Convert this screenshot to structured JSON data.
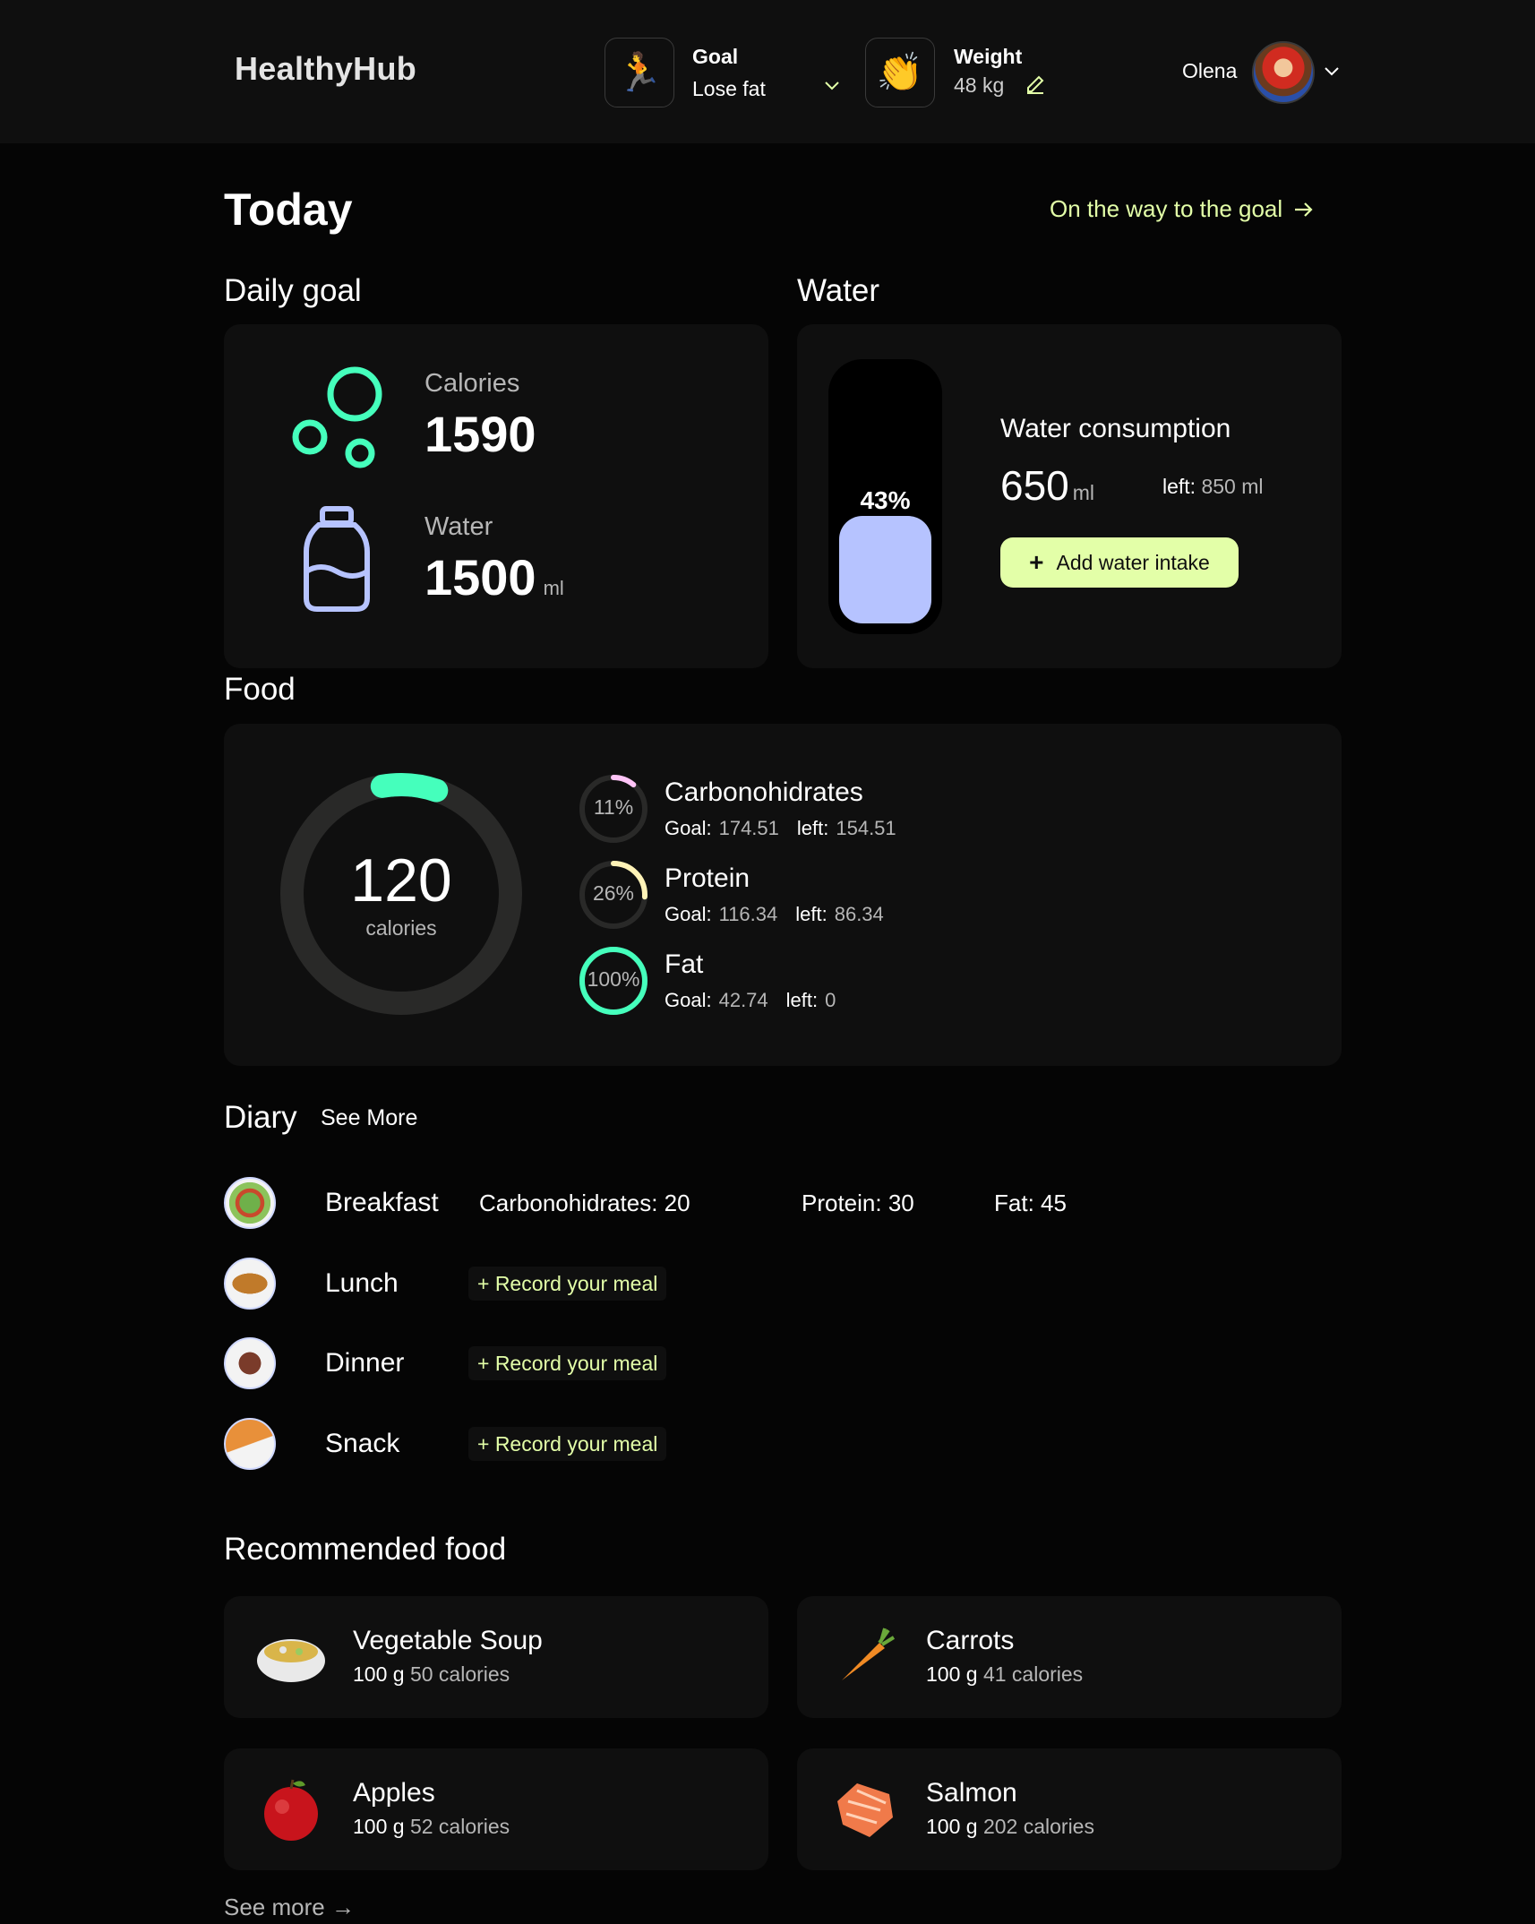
{
  "header": {
    "logo": "HealthyHub",
    "goal": {
      "label": "Goal",
      "value": "Lose fat",
      "icon": "running-person-icon"
    },
    "weight": {
      "label": "Weight",
      "value": "48 kg",
      "icon": "clapping-hands-icon"
    },
    "user": {
      "name": "Olena"
    }
  },
  "today": {
    "title": "Today",
    "goal_link": "On the way to the goal"
  },
  "daily_goal": {
    "title": "Daily goal",
    "calories_label": "Calories",
    "calories_value": "1590",
    "water_label": "Water",
    "water_value": "1500",
    "water_unit": "ml"
  },
  "water": {
    "title": "Water",
    "percent": "43%",
    "fill_fraction": 0.43,
    "consumption_label": "Water consumption",
    "amount": "650",
    "amount_unit": "ml",
    "left_label": "left:",
    "left_value": "850 ml",
    "add_button": "Add water intake",
    "fill_color": "#b6c3ff"
  },
  "food": {
    "title": "Food",
    "calories_value": "120",
    "calories_label": "calories",
    "calories_fraction": 0.08,
    "macros": [
      {
        "name": "Carbonohidrates",
        "percent": "11%",
        "fraction": 0.11,
        "color": "#ffc4f7",
        "goal_label": "Goal:",
        "goal": "174.51",
        "left_label": "left:",
        "left": "154.51"
      },
      {
        "name": "Protein",
        "percent": "26%",
        "fraction": 0.26,
        "color": "#fff3b7",
        "goal_label": "Goal:",
        "goal": "116.34",
        "left_label": "left:",
        "left": "86.34"
      },
      {
        "name": "Fat",
        "percent": "100%",
        "fraction": 1.0,
        "color": "#45ffbc",
        "goal_label": "Goal:",
        "goal": "42.74",
        "left_label": "left:",
        "left": "0"
      }
    ]
  },
  "diary": {
    "title": "Diary",
    "see_more": "See More",
    "meals": [
      {
        "name": "Breakfast",
        "carbs": "Carbonohidrates: 20",
        "protein": "Protein: 30",
        "fat": "Fat: 45"
      },
      {
        "name": "Lunch",
        "record": "+ Record your meal"
      },
      {
        "name": "Dinner",
        "record": "+ Record your meal"
      },
      {
        "name": "Snack",
        "record": "+ Record your meal"
      }
    ]
  },
  "recommended": {
    "title": "Recommended food",
    "items": [
      {
        "name": "Vegetable Soup",
        "weight": "100 g",
        "calories": "50 calories"
      },
      {
        "name": "Carrots",
        "weight": "100 g",
        "calories": "41 calories"
      },
      {
        "name": "Apples",
        "weight": "100 g",
        "calories": "52 calories"
      },
      {
        "name": "Salmon",
        "weight": "100 g",
        "calories": "202 calories"
      }
    ],
    "see_more": "See more →"
  },
  "colors": {
    "accent": "#e3ffa8",
    "green": "#45ffbc",
    "water": "#b6c3ff",
    "card": "#0f0f0f"
  }
}
